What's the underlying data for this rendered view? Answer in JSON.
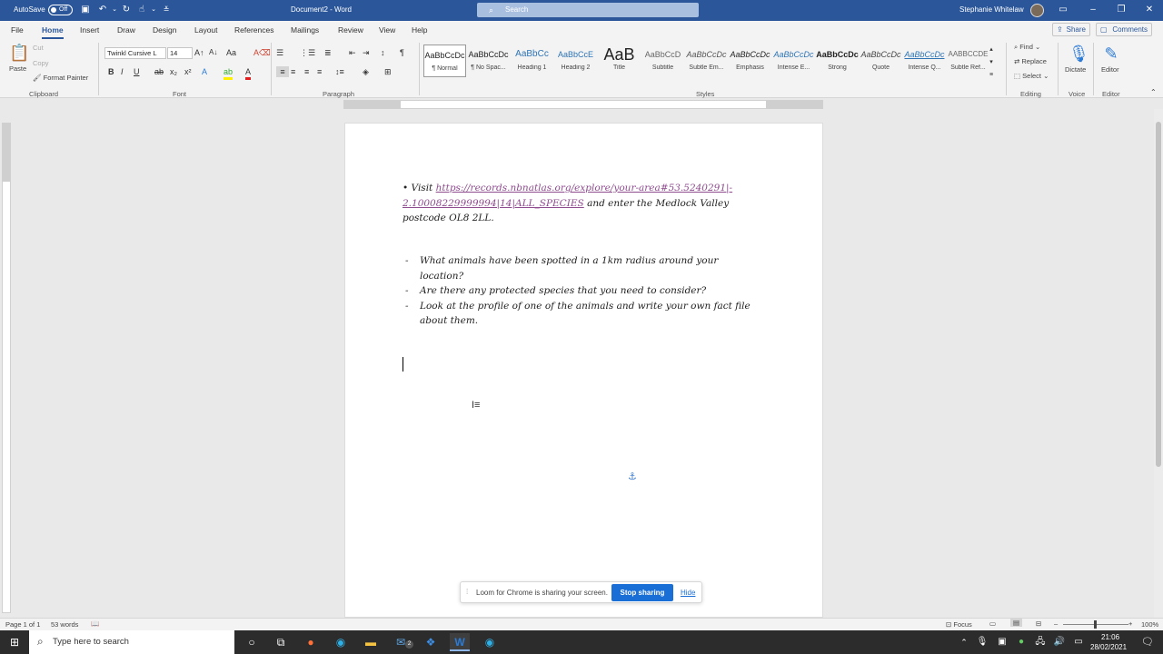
{
  "titlebar": {
    "autosave_label": "AutoSave",
    "autosave_state": "Off",
    "doc_title": "Document2 - Word",
    "search_placeholder": "Search",
    "user_name": "Stephanie Whitelaw"
  },
  "tabs": [
    "File",
    "Home",
    "Insert",
    "Draw",
    "Design",
    "Layout",
    "References",
    "Mailings",
    "Review",
    "View",
    "Help"
  ],
  "share_label": "Share",
  "comments_label": "Comments",
  "clipboard": {
    "paste": "Paste",
    "cut": "Cut",
    "copy": "Copy",
    "format_painter": "Format Painter",
    "group": "Clipboard"
  },
  "font": {
    "name": "Twinkl Cursive L",
    "size": "14",
    "group": "Font"
  },
  "paragraph": {
    "group": "Paragraph"
  },
  "styles": {
    "group": "Styles",
    "items": [
      {
        "preview": "AaBbCcDc",
        "label": "¶ Normal"
      },
      {
        "preview": "AaBbCcDc",
        "label": "¶ No Spac..."
      },
      {
        "preview": "AaBbCc",
        "label": "Heading 1"
      },
      {
        "preview": "AaBbCcE",
        "label": "Heading 2"
      },
      {
        "preview": "AaB",
        "label": "Title"
      },
      {
        "preview": "AaBbCcD",
        "label": "Subtitle"
      },
      {
        "preview": "AaBbCcDc",
        "label": "Subtle Em..."
      },
      {
        "preview": "AaBbCcDc",
        "label": "Emphasis"
      },
      {
        "preview": "AaBbCcDc",
        "label": "Intense E..."
      },
      {
        "preview": "AaBbCcDc",
        "label": "Strong"
      },
      {
        "preview": "AaBbCcDc",
        "label": "Quote"
      },
      {
        "preview": "AaBbCcDc",
        "label": "Intense Q..."
      },
      {
        "preview": "AABBCCDE",
        "label": "Subtle Ref..."
      }
    ]
  },
  "editing": {
    "find": "Find",
    "replace": "Replace",
    "select": "Select",
    "group": "Editing"
  },
  "voice": {
    "dictate": "Dictate",
    "group": "Voice"
  },
  "editor": {
    "label": "Editor",
    "group": "Editor"
  },
  "document": {
    "bullet": "•",
    "visit": "Visit",
    "link_line1": "https://records.nbnatlas.org/explore/your-area#53.5240291|-",
    "link_line2": "2.10008229999994|14|ALL_SPECIES",
    "after_link": "and enter the Medlock Valley",
    "line3": "postcode OL8 2LL.",
    "list": [
      {
        "dash": "-",
        "line1": "What animals have been spotted in a 1km radius around your",
        "line2": "location?"
      },
      {
        "dash": "-",
        "line1": "Are there any protected species that you need to consider?",
        "line2": ""
      },
      {
        "dash": "-",
        "line1": "Look at the profile of one of the animals and write your own fact file",
        "line2": "about them."
      }
    ]
  },
  "status": {
    "page": "Page 1 of 1",
    "words": "53 words",
    "focus": "Focus",
    "zoom": "100%"
  },
  "loom": {
    "message": "Loom for Chrome is sharing your screen.",
    "stop": "Stop sharing",
    "hide": "Hide"
  },
  "taskbar": {
    "search_placeholder": "Type here to search",
    "time": "21:06",
    "date": "28/02/2021",
    "mail_badge": "2"
  }
}
